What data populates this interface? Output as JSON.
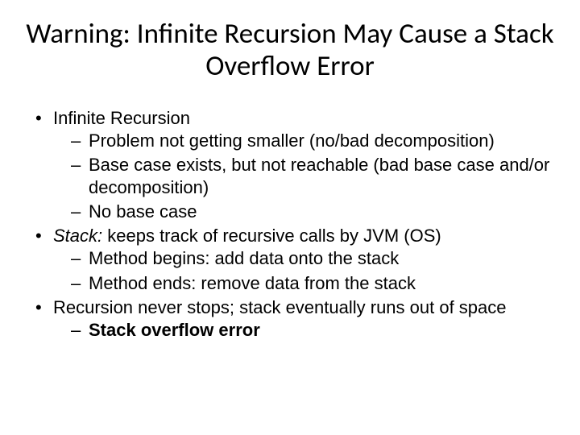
{
  "title": "Warning: Infinite Recursion May Cause a Stack Overflow Error",
  "bullets": {
    "b1": "Infinite Recursion",
    "b1_1": "Problem not getting smaller (no/bad decomposition)",
    "b1_2": "Base case exists, but not reachable (bad base case and/or decomposition)",
    "b1_3": "No base case",
    "b2_prefix": "Stack:",
    "b2_rest": " keeps track of recursive calls by JVM (OS)",
    "b2_1": "Method begins: add data onto the stack",
    "b2_2": "Method ends: remove data from the stack",
    "b3": "Recursion never stops; stack eventually runs out of space",
    "b3_1": "Stack overflow error"
  }
}
